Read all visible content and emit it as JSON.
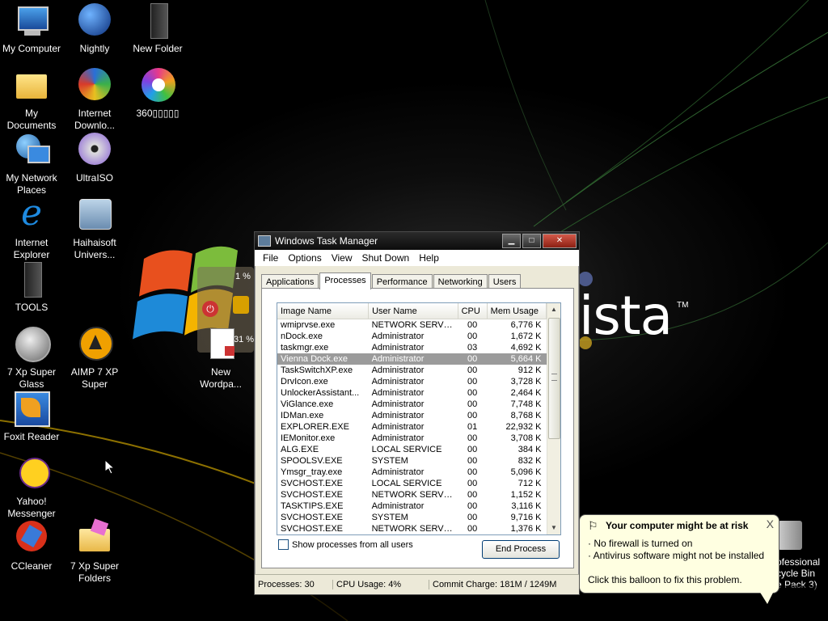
{
  "desktop": {
    "icons": [
      {
        "label": "My Computer"
      },
      {
        "label": "Nightly"
      },
      {
        "label": "New Folder"
      },
      {
        "label": "My Documents"
      },
      {
        "label": "Internet Downlo..."
      },
      {
        "label": "360▯▯▯▯▯"
      },
      {
        "label": "My Network Places"
      },
      {
        "label": "UltraISO"
      },
      {
        "label": "Internet Explorer"
      },
      {
        "label": "Haihaisoft Univers..."
      },
      {
        "label": "TOOLS"
      },
      {
        "label": "7 Xp Super Glass"
      },
      {
        "label": "AIMP 7 XP Super"
      },
      {
        "label": "New Wordpa..."
      },
      {
        "label": "Foxit Reader"
      },
      {
        "label": "Yahoo! Messenger"
      },
      {
        "label": "CCleaner"
      },
      {
        "label": "7 Xp Super Folders"
      }
    ],
    "vista_logo": "ista",
    "vista_tm": "TM",
    "gadget_values": [
      "1 %",
      "31 %"
    ],
    "partial_text": [
      "ofessional",
      "cycle Bin",
      "e Pack 3)"
    ]
  },
  "taskmgr": {
    "title": "Windows Task Manager",
    "menu": [
      "File",
      "Options",
      "View",
      "Shut Down",
      "Help"
    ],
    "tabs": [
      "Applications",
      "Processes",
      "Performance",
      "Networking",
      "Users"
    ],
    "active_tab": "Processes",
    "columns": [
      "Image Name",
      "User Name",
      "CPU",
      "Mem Usage"
    ],
    "rows": [
      [
        "wmiprvse.exe",
        "NETWORK SERVICE",
        "00",
        "6,776 K"
      ],
      [
        "nDock.exe",
        "Administrator",
        "00",
        "1,672 K"
      ],
      [
        "taskmgr.exe",
        "Administrator",
        "03",
        "4,692 K"
      ],
      [
        "Vienna Dock.exe",
        "Administrator",
        "00",
        "5,664 K"
      ],
      [
        "TaskSwitchXP.exe",
        "Administrator",
        "00",
        "912 K"
      ],
      [
        "DrvIcon.exe",
        "Administrator",
        "00",
        "3,728 K"
      ],
      [
        "UnlockerAssistant...",
        "Administrator",
        "00",
        "2,464 K"
      ],
      [
        "ViGlance.exe",
        "Administrator",
        "00",
        "7,748 K"
      ],
      [
        "IDMan.exe",
        "Administrator",
        "00",
        "8,768 K"
      ],
      [
        "EXPLORER.EXE",
        "Administrator",
        "01",
        "22,932 K"
      ],
      [
        "IEMonitor.exe",
        "Administrator",
        "00",
        "3,708 K"
      ],
      [
        "ALG.EXE",
        "LOCAL SERVICE",
        "00",
        "384 K"
      ],
      [
        "SPOOLSV.EXE",
        "SYSTEM",
        "00",
        "832 K"
      ],
      [
        "Ymsgr_tray.exe",
        "Administrator",
        "00",
        "5,096 K"
      ],
      [
        "SVCHOST.EXE",
        "LOCAL SERVICE",
        "00",
        "712 K"
      ],
      [
        "SVCHOST.EXE",
        "NETWORK SERVICE",
        "00",
        "1,152 K"
      ],
      [
        "TASKTIPS.EXE",
        "Administrator",
        "00",
        "3,116 K"
      ],
      [
        "SVCHOST.EXE",
        "SYSTEM",
        "00",
        "9,716 K"
      ],
      [
        "SVCHOST.EXE",
        "NETWORK SERVICE",
        "00",
        "1,376 K"
      ]
    ],
    "selected_row": 3,
    "show_all_label": "Show processes from all users",
    "end_process_label": "End Process",
    "status": {
      "processes": "Processes: 30",
      "cpu": "CPU Usage: 4%",
      "commit": "Commit Charge: 181M / 1249M"
    }
  },
  "balloon": {
    "title": "Your computer might be at risk",
    "line1": "· No firewall is turned on",
    "line2": "· Antivirus software might not be installed",
    "line3": "Click this balloon to fix this problem.",
    "close": "X"
  }
}
